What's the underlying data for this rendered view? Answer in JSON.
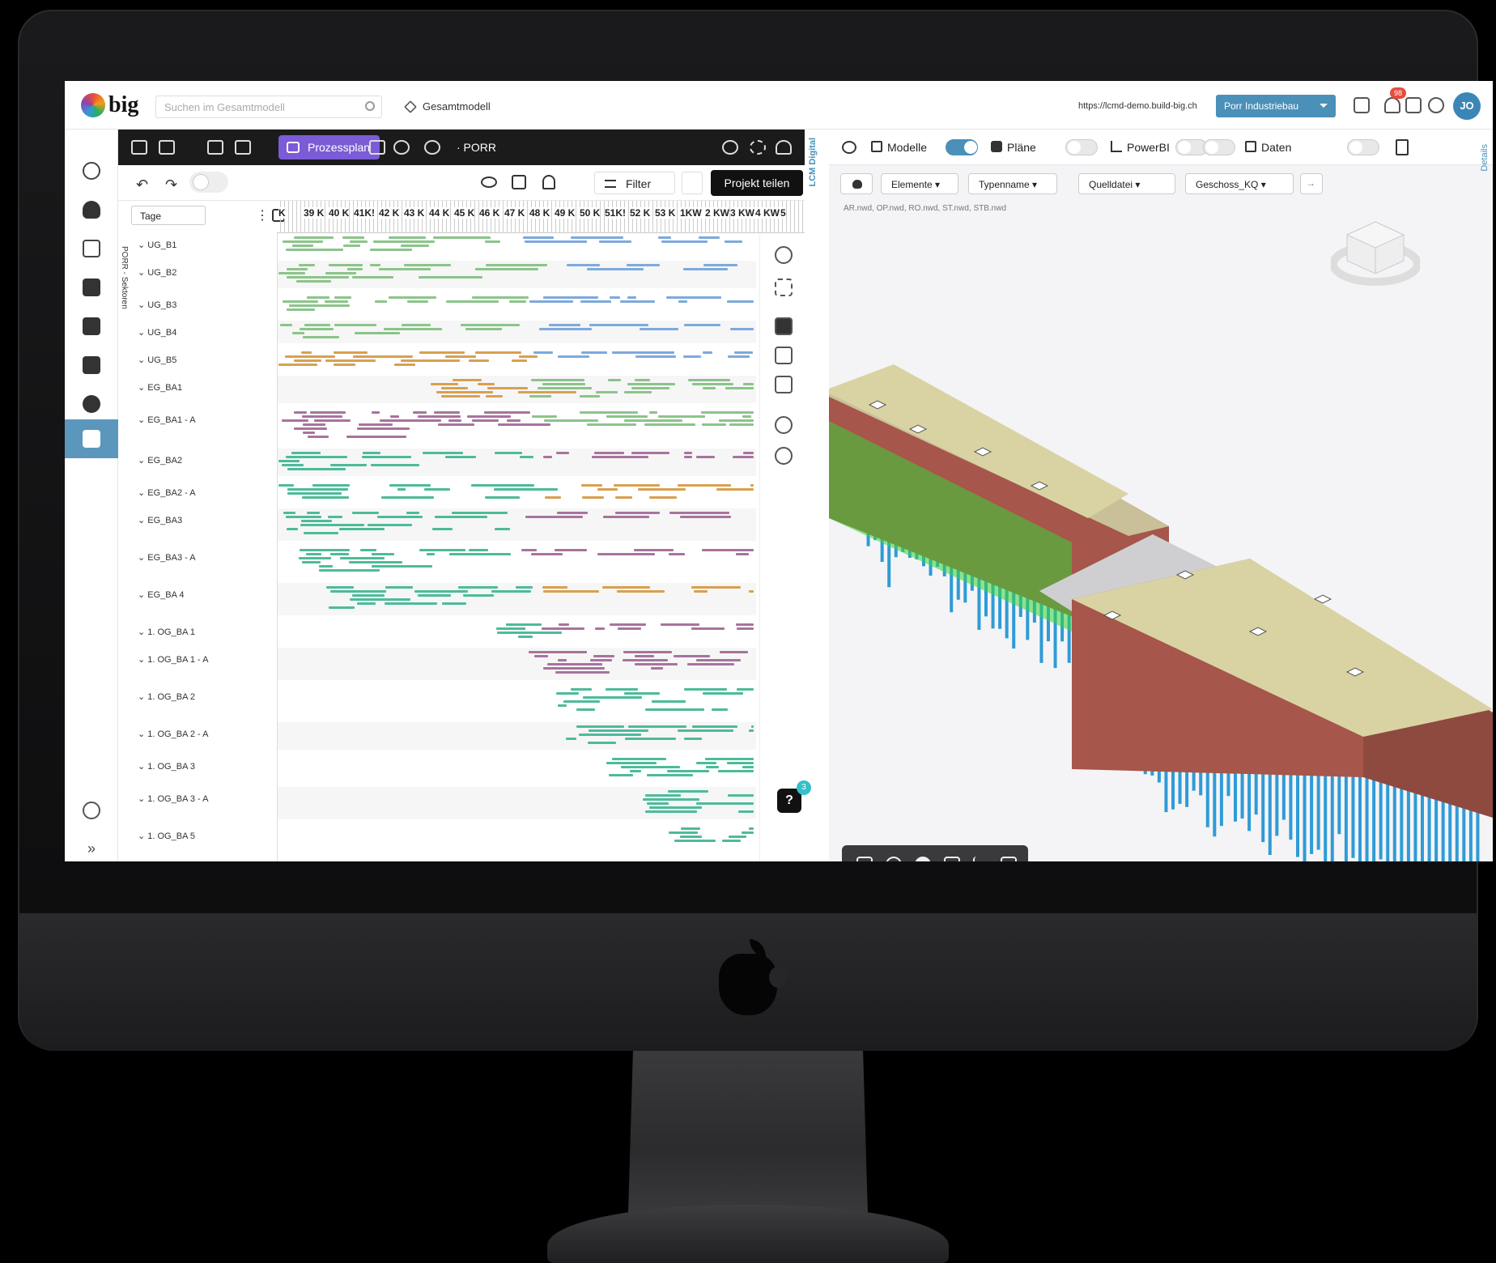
{
  "topbar": {
    "logo_text": "big",
    "search_placeholder": "Suchen im Gesamtmodell",
    "model_label": "Gesamtmodell",
    "url": "https://lcmd-demo.build-big.ch",
    "company_button": "Porr Industriebau",
    "notification_count": "98",
    "avatar_initials": "JO"
  },
  "gantt": {
    "mode_button": "Prozessplan",
    "project_label": "· PORR",
    "filter_label": "Filter",
    "share_button": "Projekt teilen",
    "unit_select": "Tage",
    "vertical_label": "PORR - Sektoren",
    "weeks": [
      "K",
      "39 K",
      "40 K",
      "41K!",
      "42 K",
      "43 K",
      "44 K",
      "45 K",
      "46 K",
      "47 K",
      "48 K",
      "49 K",
      "50 K",
      "51K!",
      "52 K",
      "53 K",
      "1KW",
      "2 KW",
      "3 KW",
      "4 KW",
      "5"
    ],
    "rows": [
      "UG_B1",
      "UG_B2",
      "UG_B3",
      "UG_B4",
      "UG_B5",
      "EG_BA1",
      "EG_BA1 - A",
      "EG_BA2",
      "EG_BA2 - A",
      "EG_BA3",
      "EG_BA3 - A",
      "EG_BA 4",
      "1. OG_BA 1",
      "1. OG_BA 1 - A",
      "1. OG_BA 2",
      "1. OG_BA 2 - A",
      "1. OG_BA 3",
      "1. OG_BA 3 - A",
      "1. OG_BA 5"
    ],
    "help_label": "?",
    "help_badge": "3"
  },
  "side_label": "LCM Digital",
  "viewer": {
    "toolbar": {
      "modelle": "Modelle",
      "plaene": "Pläne",
      "powerbi": "PowerBI",
      "daten": "Daten"
    },
    "chips": [
      "Elemente",
      "Typenname",
      "Quelldatei",
      "Geschoss_KQ"
    ],
    "files": "AR.nwd, OP.nwd, RO.nwd, ST.nwd, STB.nwd",
    "details_label": "Details",
    "colors": {
      "roof": "#d9d3a3",
      "brick": "#a6564a",
      "piles": "#2f9bd6",
      "glass": "#39d339"
    }
  },
  "colors": {
    "accent": "#4a90b8",
    "prozessplan": "#7b5bd6",
    "bar_green": "#8bc48a",
    "bar_blue": "#7ea9dc",
    "bar_purple": "#a8739e",
    "bar_orange": "#d9a050",
    "bar_teal": "#4dbb9a"
  }
}
